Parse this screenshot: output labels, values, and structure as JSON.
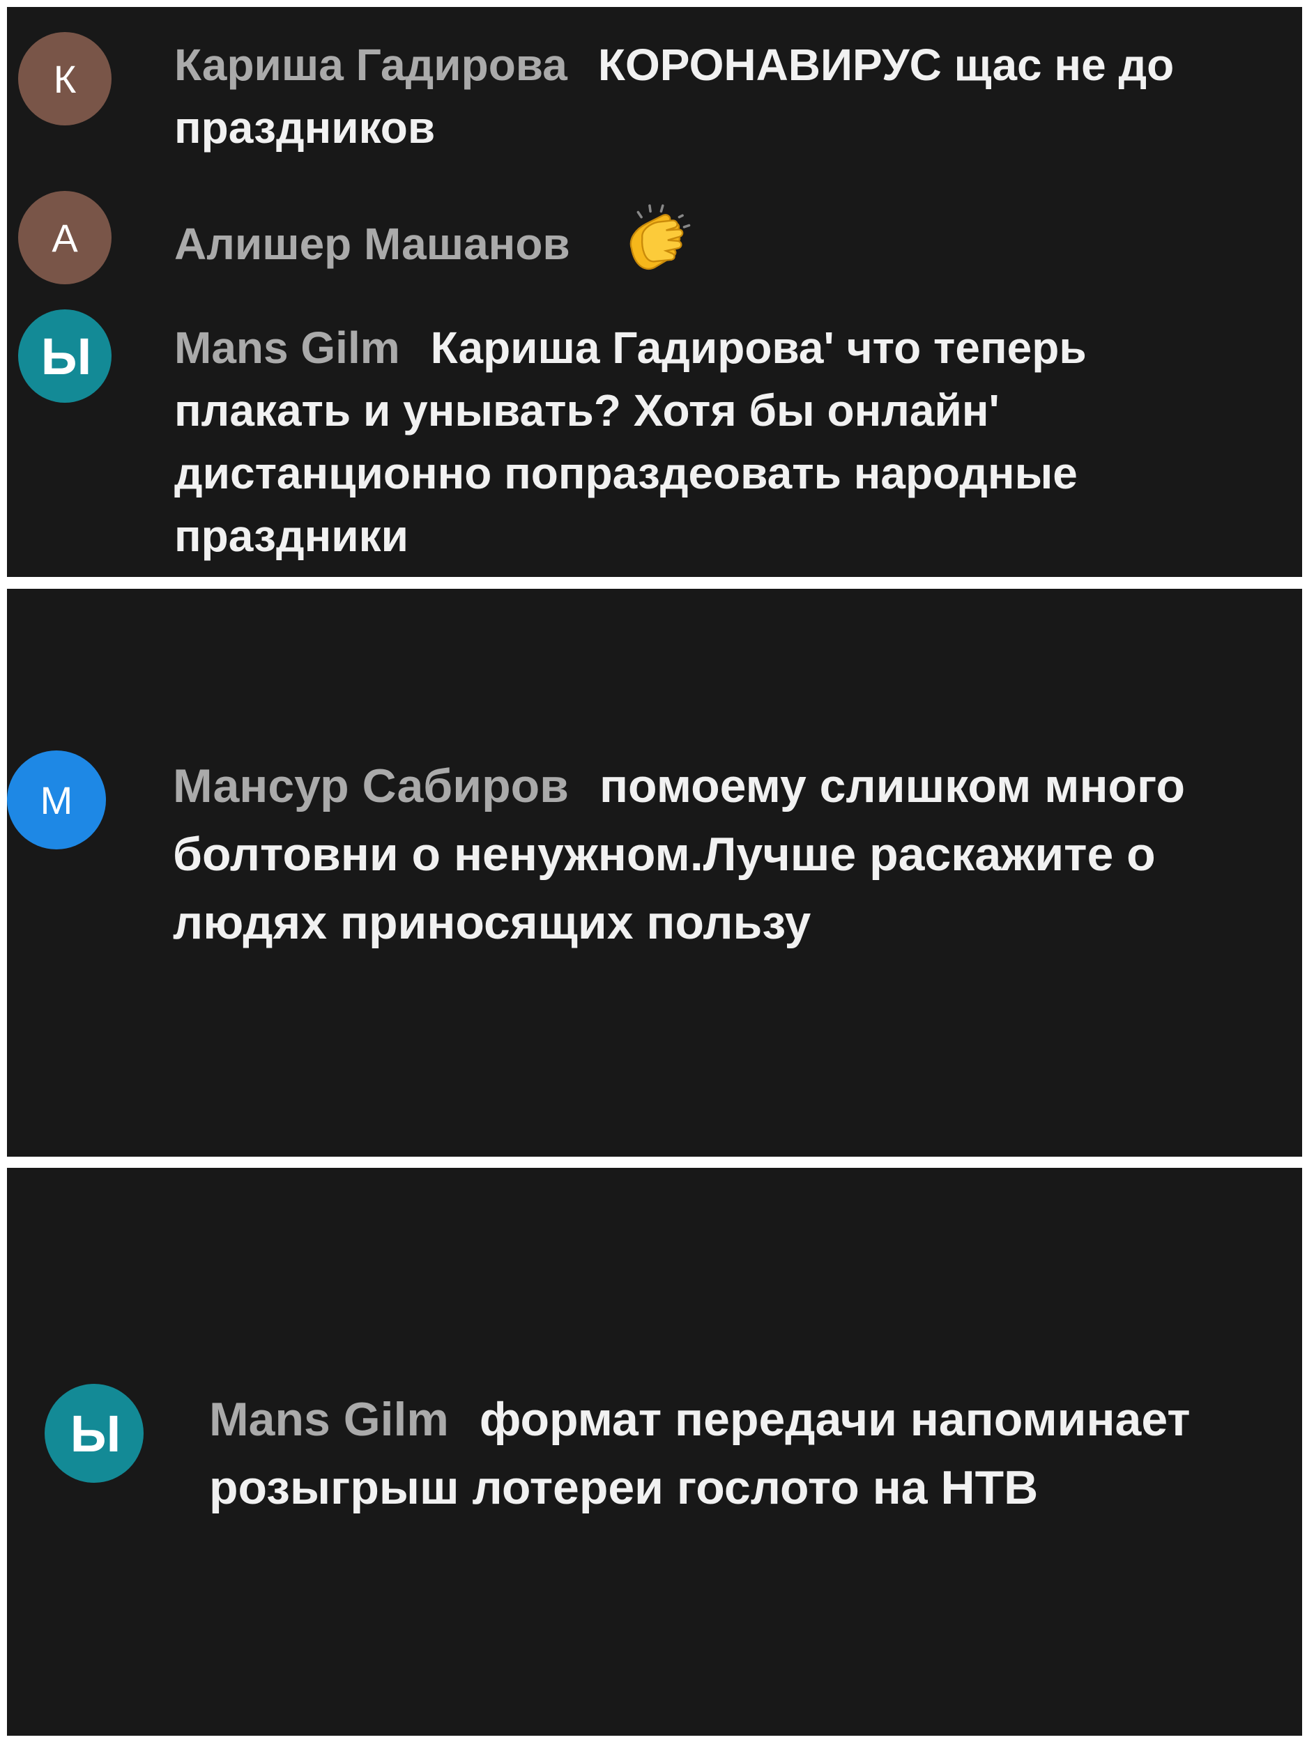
{
  "colors": {
    "page_bg": "#ffffff",
    "panel_bg": "#181818",
    "author": "#aaaaaa",
    "message": "#f1f1f1",
    "avatar_brown": "#795548",
    "avatar_teal": "#138a96",
    "avatar_blue": "#1e88e5"
  },
  "panel1": {
    "comments": [
      {
        "avatar_letter": "К",
        "avatar_color": "#795548",
        "author": "Кариша Гадирова",
        "text": "КОРОНАВИРУС щас не до праздников"
      },
      {
        "avatar_letter": "А",
        "avatar_color": "#795548",
        "author": "Алишер Машанов",
        "text": "",
        "emoji": "clapping-hands-icon"
      },
      {
        "avatar_letter": "Ы",
        "avatar_color": "#138a96",
        "author": "Mans Gilm",
        "text": "Кариша Гадирова' что теперь плакать и унывать? Хотя бы онлайн' дистанционно попраздеовать народные праздники"
      }
    ]
  },
  "panel2": {
    "comment": {
      "avatar_letter": "М",
      "avatar_color": "#1e88e5",
      "author": "Мансур Сабиров",
      "text": "помоему слишком много болтовни о ненужном.Лучше раскажите о людях приносящих пользу"
    }
  },
  "panel3": {
    "comment": {
      "avatar_letter": "Ы",
      "avatar_color": "#138a96",
      "author": "Mans Gilm",
      "text": "формат передачи напоминает розыгрыш лотереи гослото на НТВ"
    }
  }
}
